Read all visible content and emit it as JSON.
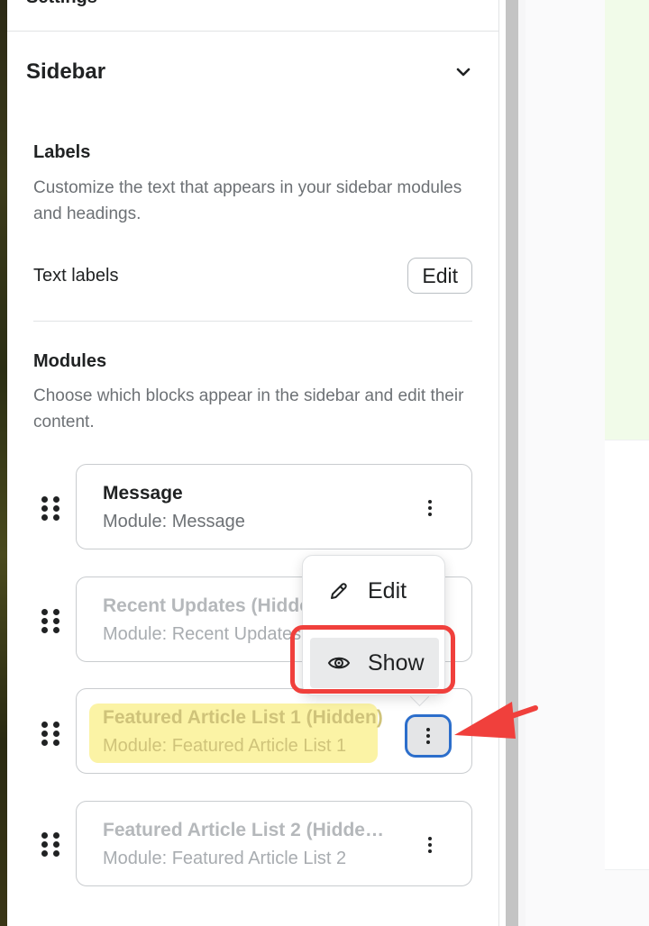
{
  "cut_off_heading": "Settings",
  "sidebar_section": {
    "title": "Sidebar",
    "chevron_icon": "chevron-down-icon"
  },
  "labels_block": {
    "heading": "Labels",
    "description": "Customize the text that appears in your sidebar modules and headings.",
    "text_labels": "Text labels",
    "edit_label": "Edit"
  },
  "modules_block": {
    "heading": "Modules",
    "description": "Choose which blocks appear in the sidebar and edit their content.",
    "items": [
      {
        "title": "Message",
        "subtitle": "Module: Message",
        "hidden": false
      },
      {
        "title": "Recent Updates (Hidden)",
        "subtitle": "Module: Recent Updates",
        "hidden": true
      },
      {
        "title": "Featured Article List 1 (Hidden)",
        "subtitle": "Module: Featured Article List 1",
        "hidden": true,
        "highlighted": true
      },
      {
        "title": "Featured Article List 2 (Hidde…",
        "subtitle": "Module: Featured Article List 2",
        "hidden": true
      }
    ]
  },
  "popover_menu": {
    "items": [
      {
        "label": "Edit",
        "icon": "pencil-icon"
      },
      {
        "label": "Show",
        "icon": "eye-icon"
      }
    ]
  },
  "colors": {
    "highlight": "#fbf3a5",
    "annotation_red": "#f0403c",
    "focus_blue": "#2c6ecb"
  }
}
